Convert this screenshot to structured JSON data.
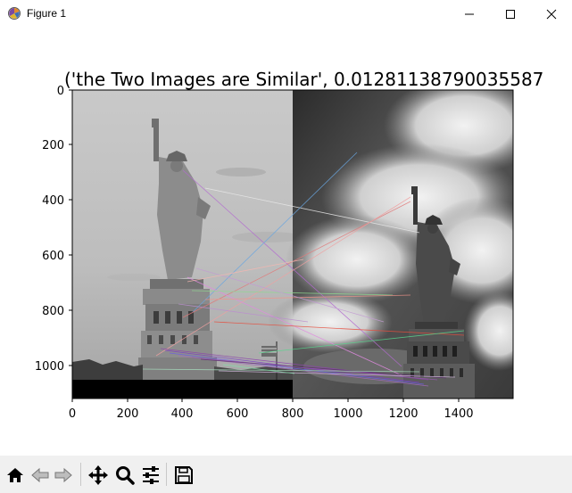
{
  "window": {
    "title": "Figure 1",
    "icons": [
      "matplotlib-icon",
      "minimize-icon",
      "maximize-icon",
      "close-icon"
    ]
  },
  "plot": {
    "title": "('the Two Images are Similar', 0.01281138790035587",
    "x_ticks": [
      "0",
      "200",
      "400",
      "600",
      "800",
      "1000",
      "1200",
      "1400"
    ],
    "y_ticks": [
      "0",
      "200",
      "400",
      "600",
      "800",
      "1000"
    ],
    "images": {
      "left": "statue-of-liberty-photo-grayscale",
      "right": "statue-of-liberty-photo-clouds"
    },
    "match_line_colors": [
      "#9b59b6",
      "#5dade2",
      "#e74c3c",
      "#58d68d",
      "#f1948a",
      "#8e44ad",
      "#ffffff"
    ]
  },
  "toolbar": {
    "icons": [
      "home-icon",
      "back-icon",
      "forward-icon",
      "pan-icon",
      "zoom-icon",
      "configure-subplots-icon",
      "save-icon"
    ]
  }
}
